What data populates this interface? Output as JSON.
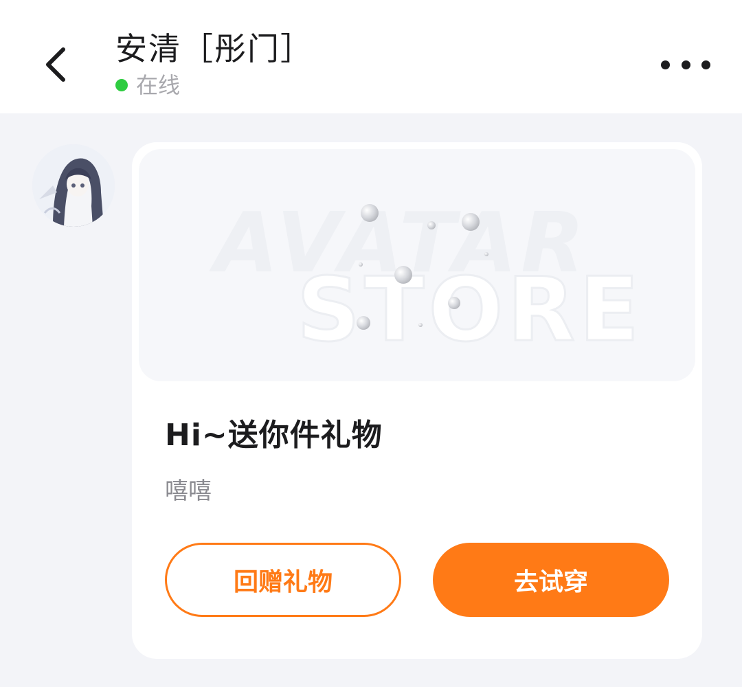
{
  "header": {
    "title": "安清［彤门］",
    "status": "在线",
    "status_color": "#2ecc40"
  },
  "message": {
    "banner_line1": "AVATAR",
    "banner_line2": "STORE",
    "title": "Hi~送你件礼物",
    "subtitle": "嘻嘻",
    "gift_back_label": "回赠礼物",
    "try_on_label": "去试穿"
  },
  "colors": {
    "accent": "#ff7a16",
    "background": "#f3f4f8",
    "card": "#ffffff"
  },
  "icons": {
    "back": "chevron-left-icon",
    "more": "more-dots-icon"
  }
}
